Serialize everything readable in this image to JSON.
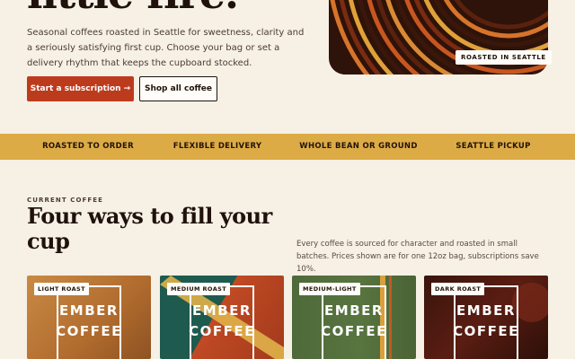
{
  "hero": {
    "title": "little fire.",
    "description": "Seasonal coffees roasted in Seattle for sweetness, clarity and a seriously satisfying first cup. Choose your bag or set a delivery rhythm that keeps the cupboard stocked.",
    "primary_button": "Start a subscription →",
    "secondary_button": "Shop all coffee",
    "badge": "ROASTED IN SEATTLE"
  },
  "features": [
    "ROASTED TO ORDER",
    "FLEXIBLE DELIVERY",
    "WHOLE BEAN OR GROUND",
    "SEATTLE PICKUP"
  ],
  "section": {
    "eyebrow": "CURRENT COFFEE",
    "title": "Four ways to fill your cup",
    "note": "Every coffee is sourced for character and roasted in small batches. Prices shown are for one 12oz bag, subscriptions save 10%."
  },
  "cards": [
    {
      "tag": "LIGHT ROAST",
      "brand_line1": "EMBER",
      "brand_line2": "COFFEE"
    },
    {
      "tag": "MEDIUM ROAST",
      "brand_line1": "EMBER",
      "brand_line2": "COFFEE"
    },
    {
      "tag": "MEDIUM-LIGHT",
      "brand_line1": "EMBER",
      "brand_line2": "COFFEE"
    },
    {
      "tag": "DARK ROAST",
      "brand_line1": "EMBER",
      "brand_line2": "COFFEE"
    }
  ],
  "colors": {
    "background": "#f6f0e5",
    "accent": "#bd3b1d",
    "band": "#ddab45"
  }
}
